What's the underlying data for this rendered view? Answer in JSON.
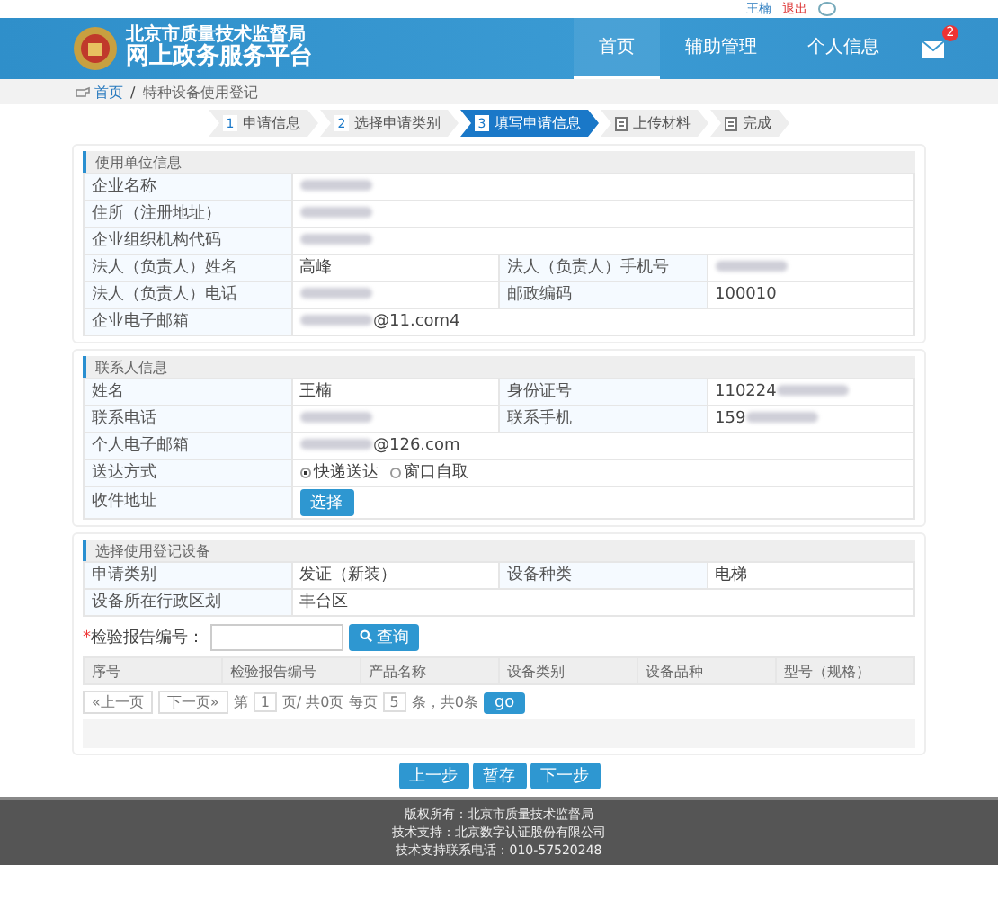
{
  "top_bar": {
    "user": "王楠",
    "logout": "退出"
  },
  "header": {
    "agency": "北京市质量技术监督局",
    "title": "网上政务服务平台",
    "mail_badge": "2",
    "nav": [
      {
        "label": "首页",
        "selected": true
      },
      {
        "label": "辅助管理",
        "selected": false
      },
      {
        "label": "个人信息",
        "selected": false
      }
    ]
  },
  "breadcrumb": {
    "home": "首页",
    "separator": "/",
    "current": "特种设备使用登记"
  },
  "steps": [
    {
      "kind": "number",
      "number": "1",
      "label": "申请信息",
      "selected": false
    },
    {
      "kind": "number",
      "number": "2",
      "label": "选择申请类别",
      "selected": false
    },
    {
      "kind": "number",
      "number": "3",
      "label": "填写申请信息",
      "selected": true
    },
    {
      "kind": "icon",
      "label": "上传材料",
      "selected": false
    },
    {
      "kind": "icon",
      "label": "完成",
      "selected": false
    }
  ],
  "sections": [
    {
      "title": "使用单位信息",
      "rows": [
        [
          {
            "kind": "label",
            "text": "企业名称"
          },
          {
            "kind": "value",
            "colspan": 3,
            "parts": [
              {
                "kind": "masked"
              }
            ]
          }
        ],
        [
          {
            "kind": "label",
            "text": "住所（注册地址）"
          },
          {
            "kind": "value",
            "colspan": 3,
            "parts": [
              {
                "kind": "masked"
              }
            ]
          }
        ],
        [
          {
            "kind": "label",
            "text": "企业组织机构代码"
          },
          {
            "kind": "value",
            "colspan": 3,
            "parts": [
              {
                "kind": "masked"
              }
            ]
          }
        ],
        [
          {
            "kind": "label",
            "text": "法人（负责人）姓名"
          },
          {
            "kind": "value",
            "parts": [
              {
                "kind": "text",
                "text": "高峰"
              }
            ]
          },
          {
            "kind": "label",
            "text": "法人（负责人）手机号"
          },
          {
            "kind": "value",
            "parts": [
              {
                "kind": "masked"
              }
            ]
          }
        ],
        [
          {
            "kind": "label",
            "text": "法人（负责人）电话"
          },
          {
            "kind": "value",
            "parts": [
              {
                "kind": "masked"
              }
            ]
          },
          {
            "kind": "label",
            "text": "邮政编码"
          },
          {
            "kind": "value",
            "parts": [
              {
                "kind": "text",
                "text": "100010"
              }
            ]
          }
        ],
        [
          {
            "kind": "label",
            "text": "企业电子邮箱"
          },
          {
            "kind": "value",
            "colspan": 3,
            "parts": [
              {
                "kind": "masked"
              },
              {
                "kind": "text",
                "text": "@11.com4"
              }
            ]
          }
        ]
      ]
    },
    {
      "title": "联系人信息",
      "rows": [
        [
          {
            "kind": "label",
            "text": "姓名"
          },
          {
            "kind": "value",
            "parts": [
              {
                "kind": "text",
                "text": "王楠"
              }
            ]
          },
          {
            "kind": "label",
            "text": "身份证号"
          },
          {
            "kind": "value",
            "parts": [
              {
                "kind": "text",
                "text": "110224"
              },
              {
                "kind": "masked"
              }
            ]
          }
        ],
        [
          {
            "kind": "label",
            "text": "联系电话"
          },
          {
            "kind": "value",
            "parts": [
              {
                "kind": "masked"
              }
            ]
          },
          {
            "kind": "label",
            "text": "联系手机"
          },
          {
            "kind": "value",
            "parts": [
              {
                "kind": "text",
                "text": "159"
              },
              {
                "kind": "masked"
              }
            ]
          }
        ],
        [
          {
            "kind": "label",
            "text": "个人电子邮箱"
          },
          {
            "kind": "value",
            "colspan": 3,
            "parts": [
              {
                "kind": "masked"
              },
              {
                "kind": "text",
                "text": "@126.com"
              }
            ]
          }
        ],
        [
          {
            "kind": "label",
            "text": "送达方式"
          },
          {
            "kind": "radios",
            "colspan": 3,
            "options": [
              {
                "label": "快递送达",
                "selected": true
              },
              {
                "label": "窗口自取",
                "selected": false
              }
            ]
          }
        ],
        [
          {
            "kind": "label",
            "text": "收件地址"
          },
          {
            "kind": "button",
            "colspan": 3,
            "label": "选择"
          }
        ]
      ]
    },
    {
      "title": "选择使用登记设备",
      "rows": [
        [
          {
            "kind": "label",
            "text": "申请类别"
          },
          {
            "kind": "value",
            "parts": [
              {
                "kind": "text",
                "text": "发证（新装）"
              }
            ]
          },
          {
            "kind": "label",
            "text": "设备种类"
          },
          {
            "kind": "value",
            "parts": [
              {
                "kind": "text",
                "text": "电梯"
              }
            ]
          }
        ],
        [
          {
            "kind": "label",
            "text": "设备所在行政区划"
          },
          {
            "kind": "value",
            "colspan": 3,
            "parts": [
              {
                "kind": "text",
                "text": "丰台区"
              }
            ]
          }
        ]
      ],
      "search": {
        "required_mark": "*",
        "label": "检验报告编号：",
        "button": "查询"
      },
      "table": {
        "columns": [
          "序号",
          "检验报告编号",
          "产品名称",
          "设备类别",
          "设备品种",
          "型号（规格）"
        ]
      },
      "pagination": {
        "prev": "«上一页",
        "next": "下一页»",
        "page_prefix": "第",
        "page": "1",
        "page_suffix": "页/ 共0页 每页",
        "size": "5",
        "size_suffix": "条，共0条",
        "go": "go"
      }
    }
  ],
  "actions": [
    "上一步",
    "暂存",
    "下一步"
  ],
  "footer": [
    "版权所有：北京市质量技术监督局",
    "技术支持：北京数字认证股份有限公司",
    "技术支持联系电话：010-57520248"
  ]
}
